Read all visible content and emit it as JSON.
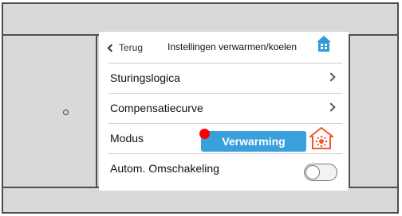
{
  "header": {
    "back_label": "Terug",
    "title": "Instellingen verwarmen/koelen",
    "home_icon": "home-icon"
  },
  "menu": {
    "items": [
      {
        "label": "Sturingslogica"
      },
      {
        "label": "Compensatiecurve"
      }
    ],
    "mode": {
      "label": "Modus",
      "value": "Verwarming",
      "icon": "heating-sun-icon"
    },
    "auto_switch": {
      "label": "Autom. Omschakeling",
      "on": false
    }
  },
  "colors": {
    "accent": "#3aa0dd",
    "heating": "#f05a28",
    "alert_dot": "#ff0000",
    "frame": "#d9d9d9"
  }
}
